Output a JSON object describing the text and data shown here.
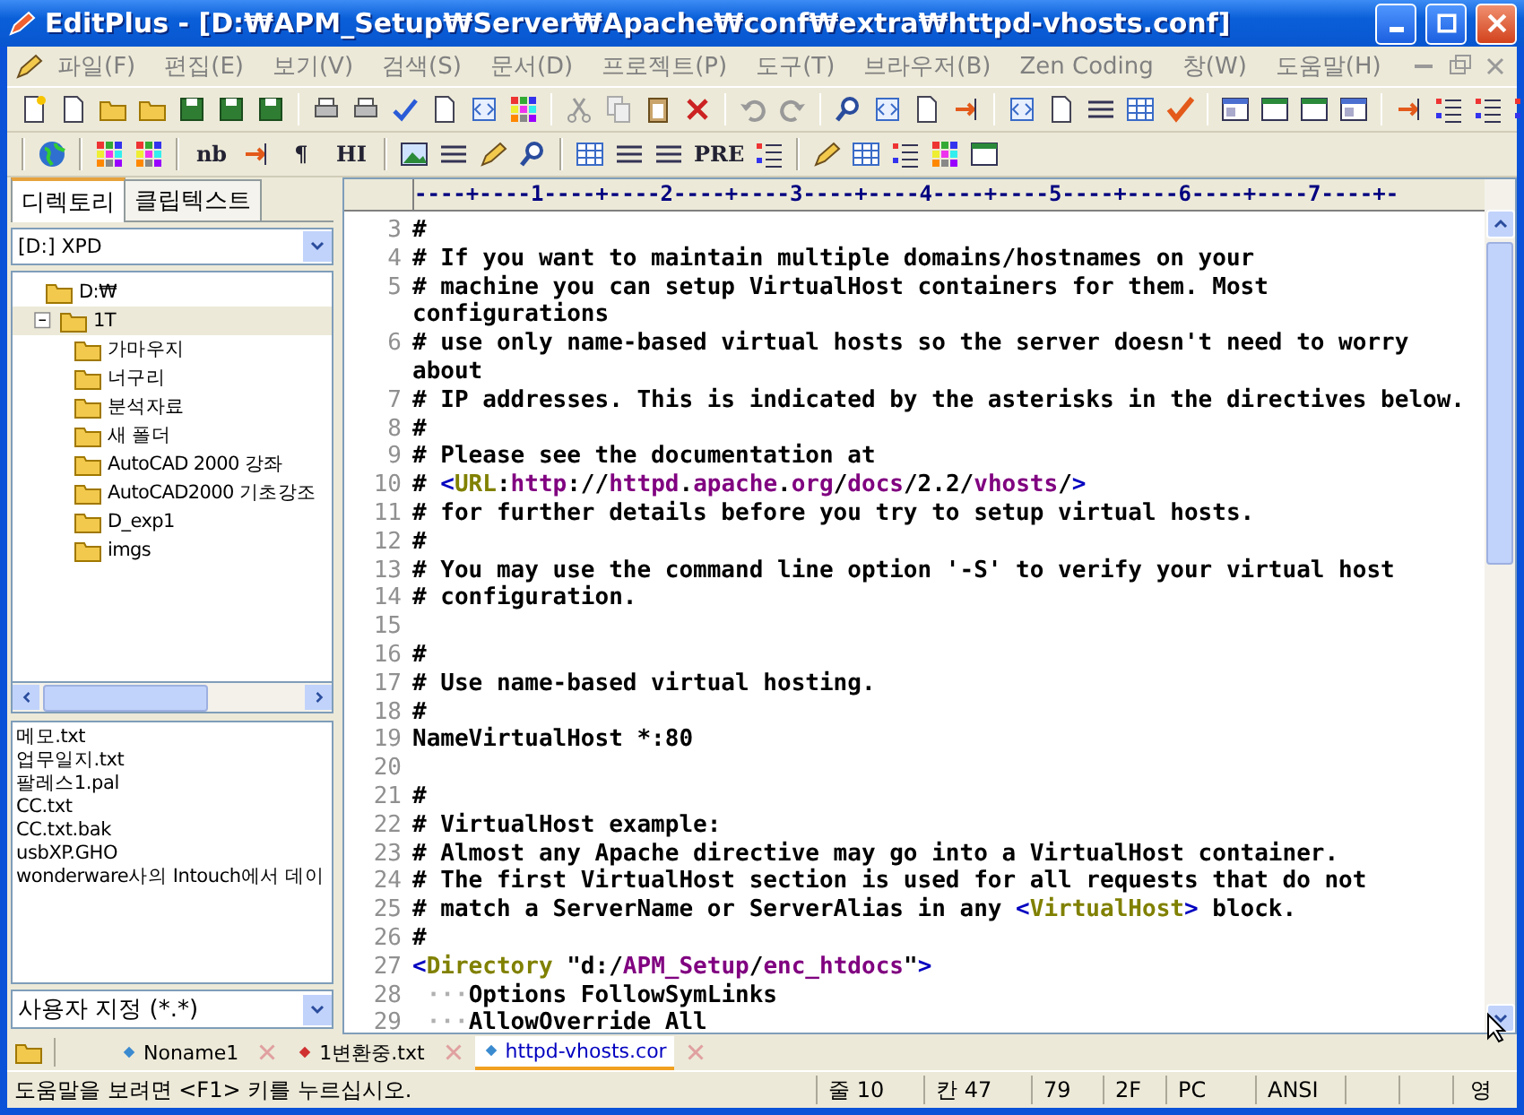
{
  "window": {
    "title": "EditPlus - [D:₩APM_Setup₩Server₩Apache₩conf₩extra₩httpd-vhosts.conf]"
  },
  "menu": [
    {
      "label": "파일(F)"
    },
    {
      "label": "편집(E)"
    },
    {
      "label": "보기(V)"
    },
    {
      "label": "검색(S)"
    },
    {
      "label": "문서(D)"
    },
    {
      "label": "프로젝트(P)"
    },
    {
      "label": "도구(T)"
    },
    {
      "label": "브라우저(B)"
    },
    {
      "label": "Zen Coding"
    },
    {
      "label": "창(W)"
    },
    {
      "label": "도움말(H)"
    }
  ],
  "format_toolbar": {
    "labels": [
      "nb",
      "¶",
      "HI",
      "PRE"
    ]
  },
  "sidebar": {
    "tabs": [
      {
        "label": "디렉토리",
        "selected": true
      },
      {
        "label": "클립텍스트",
        "selected": false
      }
    ],
    "drive": "[D:] XPD",
    "tree": [
      {
        "label": "D:₩",
        "selected": false,
        "children": [
          {
            "label": "1T",
            "selected": true,
            "expanded": true,
            "children": [
              {
                "label": "가마우지",
                "selected": false
              },
              {
                "label": "너구리",
                "selected": false
              },
              {
                "label": "분석자료",
                "selected": false
              },
              {
                "label": "새 폴더",
                "selected": false
              },
              {
                "label": "AutoCAD 2000 강좌",
                "selected": false
              },
              {
                "label": "AutoCAD2000 기초강조",
                "selected": false
              },
              {
                "label": "D_exp1",
                "selected": false
              },
              {
                "label": "imgs",
                "selected": false
              }
            ]
          }
        ]
      }
    ],
    "files": [
      "메모.txt",
      "업무일지.txt",
      "팔레스1.pal",
      "CC.txt",
      "CC.txt.bak",
      "usbXP.GHO",
      "wonderware사의 Intouch에서 데이"
    ],
    "filter": "사용자 지정 (*.*)"
  },
  "editor": {
    "ruler": "----+----1----+----2----+----3----+----4----+----5----+----6----+----7----+-",
    "lines": [
      {
        "number": "3",
        "parts": [
          {
            "text": "#",
            "kind": "plain"
          }
        ]
      },
      {
        "number": "4",
        "parts": [
          {
            "text": "# If you want to maintain multiple domains/hostnames on your",
            "kind": "plain"
          }
        ]
      },
      {
        "number": "5",
        "parts": [
          {
            "text": "# machine you can setup VirtualHost containers for them. Most",
            "kind": "plain"
          }
        ]
      },
      {
        "parts": [
          {
            "text": "configurations",
            "kind": "plain"
          }
        ]
      },
      {
        "number": "6",
        "parts": [
          {
            "text": "# use only name-based virtual hosts so the server doesn't need to worry",
            "kind": "plain"
          }
        ]
      },
      {
        "parts": [
          {
            "text": "about",
            "kind": "plain"
          }
        ]
      },
      {
        "number": "7",
        "parts": [
          {
            "text": "# IP addresses. This is indicated by the asterisks in the directives below.",
            "kind": "plain"
          }
        ]
      },
      {
        "number": "8",
        "parts": [
          {
            "text": "#",
            "kind": "plain"
          }
        ]
      },
      {
        "number": "9",
        "parts": [
          {
            "text": "# Please see the documentation at",
            "kind": "plain"
          }
        ]
      },
      {
        "number": "10",
        "parts": [
          {
            "text": "# ",
            "kind": "plain"
          },
          {
            "text": "<",
            "kind": "bracket"
          },
          {
            "text": "URL",
            "kind": "tag"
          },
          {
            "text": ":",
            "kind": "plain"
          },
          {
            "text": "http",
            "kind": "value"
          },
          {
            "text": "://",
            "kind": "plain"
          },
          {
            "text": "httpd",
            "kind": "value"
          },
          {
            "text": ".",
            "kind": "plain"
          },
          {
            "text": "apache",
            "kind": "value"
          },
          {
            "text": ".",
            "kind": "plain"
          },
          {
            "text": "org",
            "kind": "value"
          },
          {
            "text": "/",
            "kind": "plain"
          },
          {
            "text": "docs",
            "kind": "value"
          },
          {
            "text": "/2.2/",
            "kind": "plain"
          },
          {
            "text": "vhosts",
            "kind": "value"
          },
          {
            "text": "/",
            "kind": "plain"
          },
          {
            "text": ">",
            "kind": "bracket"
          }
        ]
      },
      {
        "number": "11",
        "parts": [
          {
            "text": "# for further details before you try to setup virtual hosts.",
            "kind": "plain"
          }
        ]
      },
      {
        "number": "12",
        "parts": [
          {
            "text": "#",
            "kind": "plain"
          }
        ]
      },
      {
        "number": "13",
        "parts": [
          {
            "text": "# You may use the command line option '-S' to verify your virtual host",
            "kind": "plain"
          }
        ]
      },
      {
        "number": "14",
        "parts": [
          {
            "text": "# configuration.",
            "kind": "plain"
          }
        ]
      },
      {
        "number": "15"
      },
      {
        "number": "16",
        "parts": [
          {
            "text": "#",
            "kind": "plain"
          }
        ]
      },
      {
        "number": "17",
        "parts": [
          {
            "text": "# Use name-based virtual hosting.",
            "kind": "plain"
          }
        ]
      },
      {
        "number": "18",
        "parts": [
          {
            "text": "#",
            "kind": "plain"
          }
        ]
      },
      {
        "number": "19",
        "parts": [
          {
            "text": "NameVirtualHost *:80",
            "kind": "plain"
          }
        ]
      },
      {
        "number": "20"
      },
      {
        "number": "21",
        "parts": [
          {
            "text": "#",
            "kind": "plain"
          }
        ]
      },
      {
        "number": "22",
        "parts": [
          {
            "text": "# VirtualHost example:",
            "kind": "plain"
          }
        ]
      },
      {
        "number": "23",
        "parts": [
          {
            "text": "# Almost any Apache directive may go into a VirtualHost container.",
            "kind": "plain"
          }
        ]
      },
      {
        "number": "24",
        "parts": [
          {
            "text": "# The first VirtualHost section is used for all requests that do not",
            "kind": "plain"
          }
        ]
      },
      {
        "number": "25",
        "parts": [
          {
            "text": "# match a ServerName or ServerAlias in any ",
            "kind": "plain"
          },
          {
            "text": "<",
            "kind": "bracket"
          },
          {
            "text": "VirtualHost",
            "kind": "tag"
          },
          {
            "text": ">",
            "kind": "bracket"
          },
          {
            "text": " block.",
            "kind": "plain"
          }
        ]
      },
      {
        "number": "26",
        "parts": [
          {
            "text": "#",
            "kind": "plain"
          }
        ]
      },
      {
        "number": "27",
        "parts": [
          {
            "text": "<",
            "kind": "bracket"
          },
          {
            "text": "Directory",
            "kind": "tag"
          },
          {
            "text": " \"d:/",
            "kind": "plain"
          },
          {
            "text": "APM_Setup",
            "kind": "value"
          },
          {
            "text": "/",
            "kind": "plain"
          },
          {
            "text": "enc_htdocs",
            "kind": "value"
          },
          {
            "text": "\"",
            "kind": "plain"
          },
          {
            "text": ">",
            "kind": "bracket"
          }
        ]
      },
      {
        "number": "28",
        "parts": [
          {
            "text": " ···",
            "kind": "whitespace"
          },
          {
            "text": "Options FollowSymLinks",
            "kind": "plain"
          }
        ]
      },
      {
        "number": "29",
        "parts": [
          {
            "text": " ···",
            "kind": "whitespace"
          },
          {
            "text": "AllowOverride All",
            "kind": "plain"
          }
        ]
      }
    ]
  },
  "document_tabs": [
    {
      "label": "Noname1",
      "selected": false
    },
    {
      "label": "1변환중.txt",
      "selected": false
    },
    {
      "label": "httpd-vhosts.cor",
      "selected": true
    }
  ],
  "status_bar": {
    "message": "도움말을 보려면 <F1> 키를 누르십시오.",
    "fields": [
      "줄 10",
      "칸 47",
      "79",
      "2F",
      "PC",
      "ANSI"
    ],
    "input_mode": "영"
  }
}
